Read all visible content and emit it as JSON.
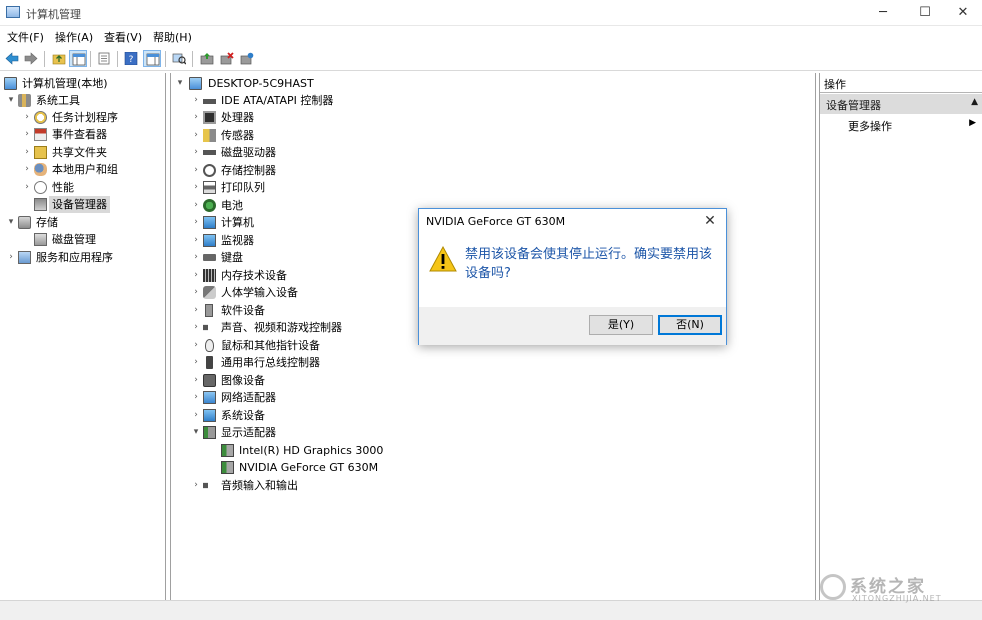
{
  "window": {
    "title": "计算机管理",
    "controls": {
      "minimize": "─",
      "maximize": "☐",
      "close": "✕"
    }
  },
  "menu": [
    "文件(F)",
    "操作(A)",
    "查看(V)",
    "帮助(H)"
  ],
  "left_tree": [
    {
      "label": "计算机管理(本地)",
      "icon": "computer-icon",
      "arrow": ""
    },
    {
      "label": "系统工具",
      "icon": "tools-icon",
      "arrow": "▾"
    },
    {
      "label": "任务计划程序",
      "icon": "clock-icon",
      "arrow": "›"
    },
    {
      "label": "事件查看器",
      "icon": "event-icon",
      "arrow": "›"
    },
    {
      "label": "共享文件夹",
      "icon": "share-icon",
      "arrow": "›"
    },
    {
      "label": "本地用户和组",
      "icon": "users-icon",
      "arrow": "›"
    },
    {
      "label": "性能",
      "icon": "performance-icon",
      "arrow": "›"
    },
    {
      "label": "设备管理器",
      "icon": "device-manager-icon",
      "arrow": ""
    },
    {
      "label": "存储",
      "icon": "storage-icon",
      "arrow": "▾"
    },
    {
      "label": "磁盘管理",
      "icon": "disk-icon",
      "arrow": ""
    },
    {
      "label": "服务和应用程序",
      "icon": "services-icon",
      "arrow": "›"
    }
  ],
  "device_tree": {
    "root": "DESKTOP-5C9HAST",
    "categories": [
      "IDE ATA/ATAPI 控制器",
      "处理器",
      "传感器",
      "磁盘驱动器",
      "存储控制器",
      "打印队列",
      "电池",
      "计算机",
      "监视器",
      "键盘",
      "内存技术设备",
      "人体学输入设备",
      "软件设备",
      "声音、视频和游戏控制器",
      "鼠标和其他指针设备",
      "通用串行总线控制器",
      "图像设备",
      "网络适配器",
      "系统设备",
      "显示适配器"
    ],
    "display_adapters": [
      "Intel(R) HD Graphics 3000",
      "NVIDIA GeForce GT 630M"
    ],
    "last_category": "音频输入和输出"
  },
  "actions": {
    "header": "操作",
    "section": "设备管理器",
    "item": "更多操作"
  },
  "dialog": {
    "title": "NVIDIA GeForce GT 630M",
    "message": "禁用该设备会使其停止运行。确实要禁用该设备吗?",
    "yes": "是(Y)",
    "no": "否(N)"
  },
  "watermark": {
    "text": "系统之家",
    "sub": "XITONGZHIJIA.NET"
  },
  "colors": {
    "accent": "#0078d7",
    "message": "#1d56a8",
    "selection": "#d9d9d9"
  }
}
